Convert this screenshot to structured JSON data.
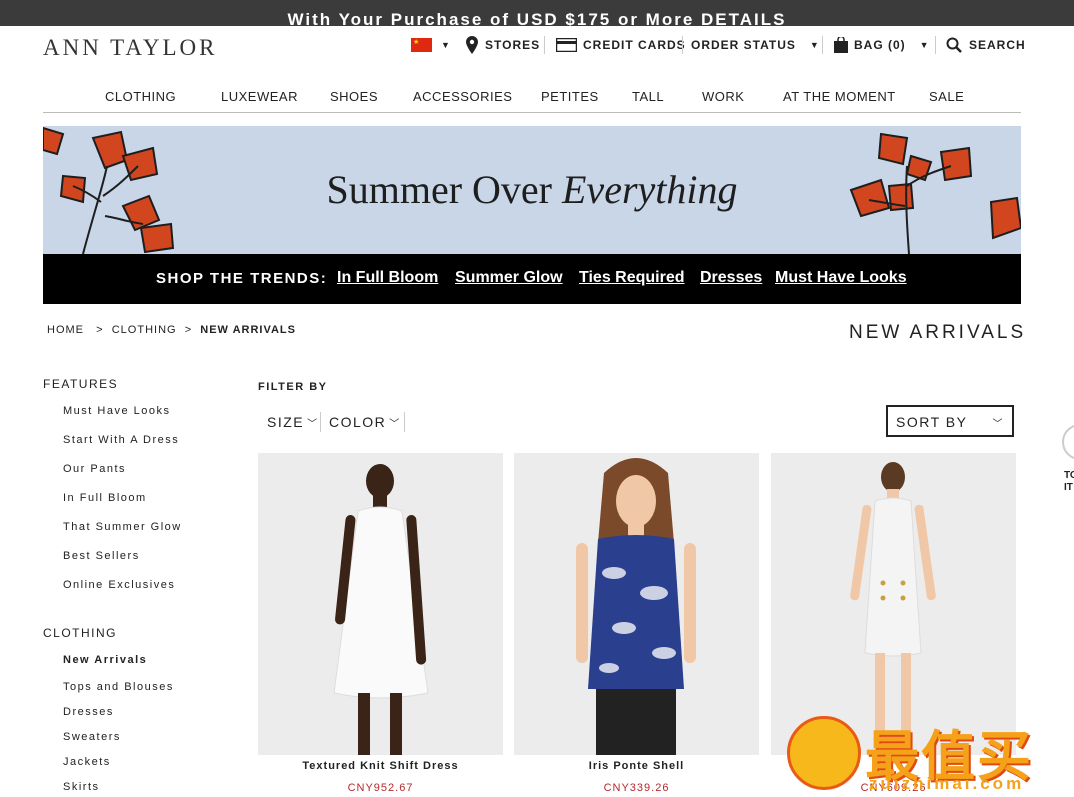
{
  "promo": {
    "text": "With Your Purchase of USD $175 or More DETAILS"
  },
  "brand": {
    "logo": "ANN TAYLOR"
  },
  "utility": {
    "stores": "STORES",
    "credit_cards": "CREDIT CARDS",
    "order_status": "ORDER STATUS",
    "bag": "BAG (0)",
    "search": "SEARCH"
  },
  "nav": {
    "items": [
      "CLOTHING",
      "LUXEWEAR",
      "SHOES",
      "ACCESSORIES",
      "PETITES",
      "TALL",
      "WORK",
      "AT THE MOMENT",
      "SALE"
    ]
  },
  "banner": {
    "title_plain": "Summer Over",
    "title_italic": "Everything",
    "trends_label": "SHOP THE TRENDS:",
    "trends": [
      "In Full Bloom",
      "Summer Glow",
      "Ties Required",
      "Dresses",
      "Must Have Looks"
    ]
  },
  "breadcrumb": {
    "home": "HOME",
    "sep": ">",
    "clothing": "CLOTHING",
    "current": "NEW ARRIVALS"
  },
  "page_title": "NEW ARRIVALS",
  "sidebar": {
    "features_heading": "FEATURES",
    "features": [
      "Must Have Looks",
      "Start With A Dress",
      "Our Pants",
      "In Full Bloom",
      "That Summer Glow",
      "Best Sellers",
      "Online Exclusives"
    ],
    "clothing_heading": "CLOTHING",
    "clothing": [
      "New Arrivals",
      "Tops and Blouses",
      "Dresses",
      "Sweaters",
      "Jackets",
      "Skirts"
    ]
  },
  "filters": {
    "label": "FILTER BY",
    "size": "SIZE",
    "color": "COLOR",
    "sort": "SORT BY"
  },
  "products": [
    {
      "name": "Textured Knit Shift Dress",
      "price": "CNY952.67"
    },
    {
      "name": "Iris Ponte Shell",
      "price": "CNY339.26"
    },
    {
      "name": "",
      "price": "CNY609.26"
    }
  ],
  "edge": {
    "line1": "TO",
    "line2": "IT"
  },
  "watermark": {
    "text": "最值买",
    "sub": "zuizhimai.com"
  },
  "colors": {
    "promo_bg": "#3b3b3b",
    "banner_bg": "#c8d6e8",
    "flower": "#d2461f",
    "trends_bg": "#000000",
    "price": "#b5292e",
    "watermark": "#f5a21a"
  }
}
